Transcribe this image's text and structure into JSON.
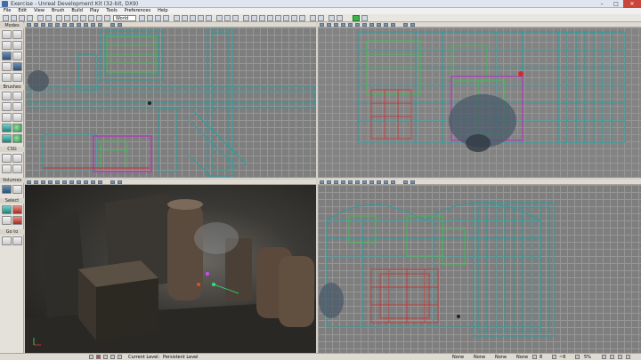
{
  "window": {
    "title": "Exercise - Unreal Development Kit (32-bit, DX9)",
    "controls": [
      "–",
      "□",
      "✕"
    ]
  },
  "menu": [
    "File",
    "Edit",
    "View",
    "Brush",
    "Build",
    "Play",
    "Tools",
    "Preferences",
    "Help"
  ],
  "toolbar": {
    "coordinate_mode": "World"
  },
  "sidebar": {
    "sections": [
      "Modes",
      "Brushes",
      "CSG",
      "Volumes",
      "Select",
      "Go to"
    ]
  },
  "status": {
    "current_level_label": "Current Level:",
    "current_level_value": "Persistent Level",
    "snap_values": [
      "None",
      "None",
      "None",
      "None"
    ],
    "grid_size": "8",
    "rotation_snap": "~6",
    "scale_percent": "5%"
  },
  "colors": {
    "wire_teal": "#1aa3a3",
    "wire_green": "#2ec94a",
    "wire_magenta": "#b23bb8",
    "wire_red": "#d42a2a",
    "selected_viewport": "#e6e24a",
    "grid": "#7e7e7e"
  }
}
